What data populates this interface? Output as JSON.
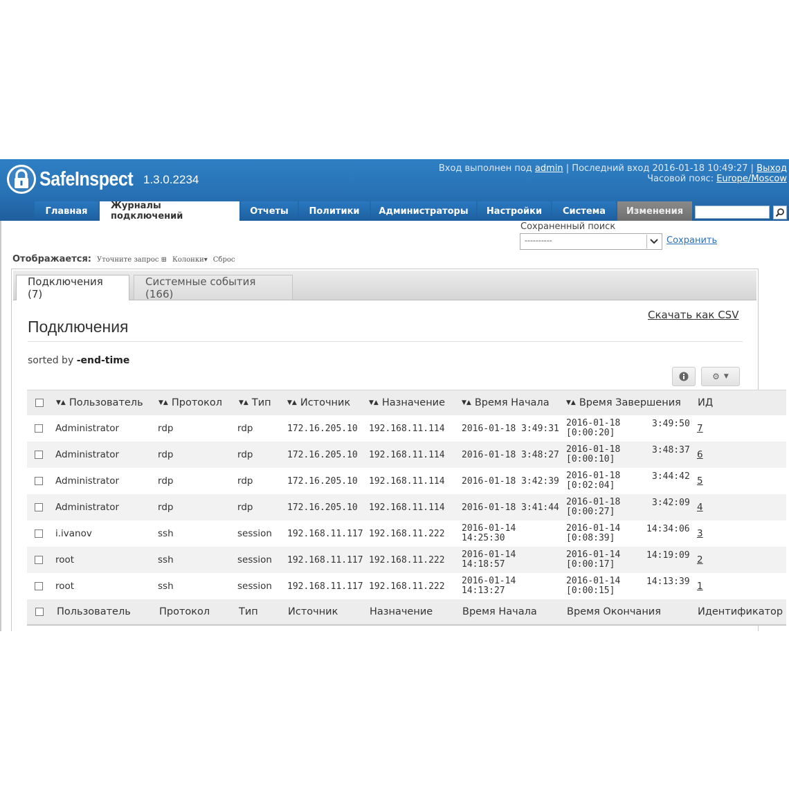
{
  "header": {
    "brand": "SafeInspect",
    "version": "1.3.0.2234",
    "login_prefix": "Вход выполнен под",
    "user": "admin",
    "last_login": "| Последний вход 2016-01-18 10:49:27 |",
    "logout": "Выход",
    "timezone_label": "Часовой пояс:",
    "timezone": "Europe/Moscow"
  },
  "nav": [
    {
      "label": "Главная"
    },
    {
      "label": "Журналы подключений"
    },
    {
      "label": "Отчеты"
    },
    {
      "label": "Политики"
    },
    {
      "label": "Администраторы"
    },
    {
      "label": "Настройки"
    },
    {
      "label": "Система"
    },
    {
      "label": "Изменения"
    }
  ],
  "saved_search": {
    "label": "Сохраненный поиск",
    "selected": "----------",
    "save": "Сохранить"
  },
  "display": {
    "label": "Отображается:",
    "refine": "Уточните запрос",
    "columns": "Колонки",
    "reset": "Сброс"
  },
  "tabs": [
    {
      "label": "Подключения (7)"
    },
    {
      "label": "Системные события (166)"
    }
  ],
  "panel": {
    "title": "Подключения",
    "csv": "Скачать как CSV",
    "sorted_prefix": "sorted by",
    "sorted_field": "-end-time"
  },
  "table": {
    "headers": {
      "user": "Пользователь",
      "protocol": "Протокол",
      "type": "Тип",
      "source": "Источник",
      "dest": "Назначение",
      "start": "Время Начала",
      "end": "Время Завершения",
      "id": "ИД"
    },
    "footers": {
      "user": "Пользователь",
      "protocol": "Протокол",
      "type": "Тип",
      "source": "Источник",
      "dest": "Назначение",
      "start": "Время Начала",
      "end": "Время Окончания",
      "id": "Идентификатор"
    },
    "rows": [
      {
        "user": "Administrator",
        "protocol": "rdp",
        "type": "rdp",
        "source": "172.16.205.10",
        "dest": "192.168.11.114",
        "start_date": "2016-01-18 3:49:31",
        "start_time": "",
        "end_date": "2016-01-18",
        "end_duration": "[0:00:20]",
        "end_clock": "3:49:50",
        "id": "7"
      },
      {
        "user": "Administrator",
        "protocol": "rdp",
        "type": "rdp",
        "source": "172.16.205.10",
        "dest": "192.168.11.114",
        "start_date": "2016-01-18 3:48:27",
        "start_time": "",
        "end_date": "2016-01-18",
        "end_duration": "[0:00:10]",
        "end_clock": "3:48:37",
        "id": "6"
      },
      {
        "user": "Administrator",
        "protocol": "rdp",
        "type": "rdp",
        "source": "172.16.205.10",
        "dest": "192.168.11.114",
        "start_date": "2016-01-18 3:42:39",
        "start_time": "",
        "end_date": "2016-01-18",
        "end_duration": "[0:02:04]",
        "end_clock": "3:44:42",
        "id": "5"
      },
      {
        "user": "Administrator",
        "protocol": "rdp",
        "type": "rdp",
        "source": "172.16.205.10",
        "dest": "192.168.11.114",
        "start_date": "2016-01-18 3:41:44",
        "start_time": "",
        "end_date": "2016-01-18",
        "end_duration": "[0:00:27]",
        "end_clock": "3:42:09",
        "id": "4"
      },
      {
        "user": "i.ivanov",
        "protocol": "ssh",
        "type": "session",
        "source": "192.168.11.117",
        "dest": "192.168.11.222",
        "start_date": "2016-01-14",
        "start_time": "14:25:30",
        "end_date": "2016-01-14",
        "end_duration": "[0:08:39]",
        "end_clock": "14:34:06",
        "id": "3"
      },
      {
        "user": "root",
        "protocol": "ssh",
        "type": "session",
        "source": "192.168.11.117",
        "dest": "192.168.11.222",
        "start_date": "2016-01-14",
        "start_time": "14:18:57",
        "end_date": "2016-01-14",
        "end_duration": "[0:00:17]",
        "end_clock": "14:19:09",
        "id": "2"
      },
      {
        "user": "root",
        "protocol": "ssh",
        "type": "session",
        "source": "192.168.11.117",
        "dest": "192.168.11.222",
        "start_date": "2016-01-14",
        "start_time": "14:13:27",
        "end_date": "2016-01-14",
        "end_duration": "[0:00:15]",
        "end_clock": "14:13:39",
        "id": "1"
      }
    ]
  }
}
